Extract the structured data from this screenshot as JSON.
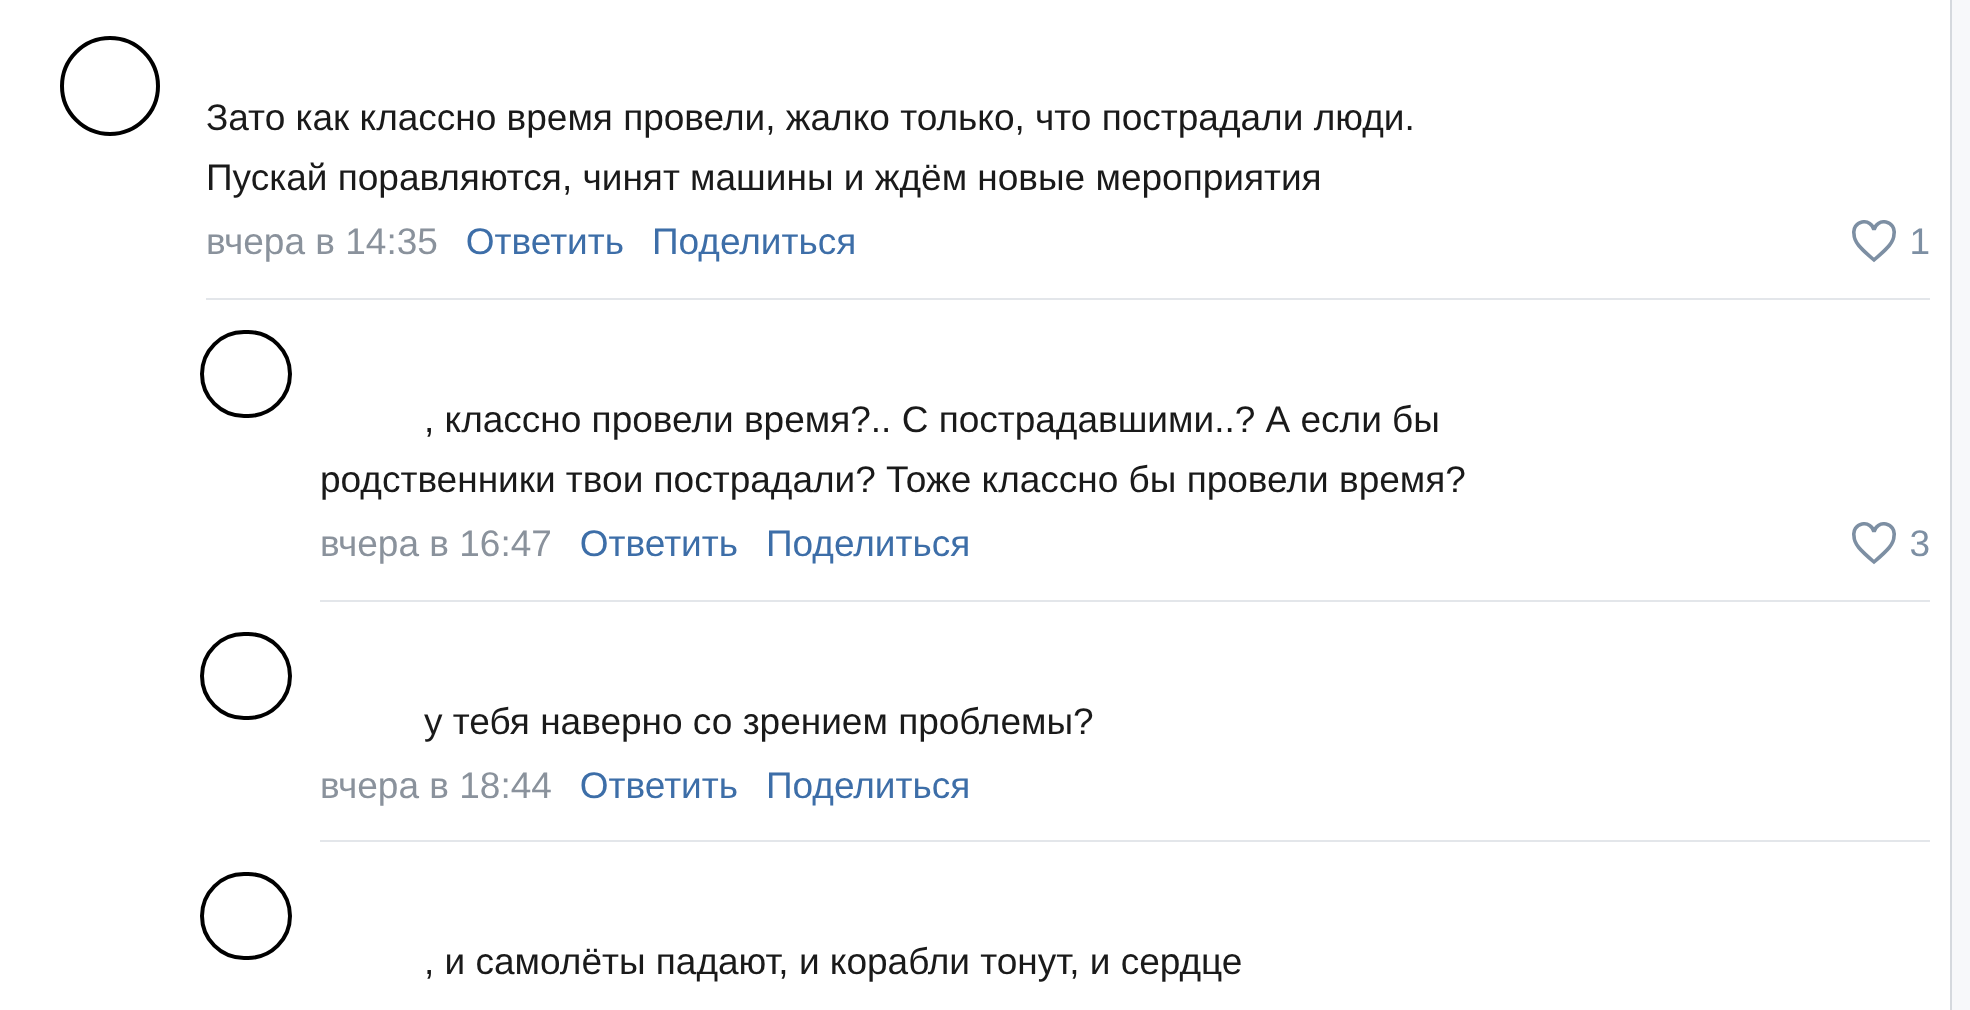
{
  "comments": [
    {
      "kind": "top",
      "text": "Зато как классно время провели, жалко только, что пострадали люди.\nПускай поравляются, чинят машины и ждём новые мероприятия",
      "time": "вчера в 14:35",
      "actions": [
        "Ответить",
        "Поделиться"
      ],
      "likes": "1"
    },
    {
      "kind": "reply",
      "text": ", классно провели время?.. С пострадавшими..? А если бы\nродственники твои пострадали? Тоже классно бы провели время?",
      "time": "вчера в 16:47",
      "actions": [
        "Ответить",
        "Поделиться"
      ],
      "likes": "3"
    },
    {
      "kind": "reply",
      "text": "у тебя наверно со зрением проблемы?",
      "time": "вчера в 18:44",
      "actions": [
        "Ответить",
        "Поделиться"
      ]
    },
    {
      "kind": "reply",
      "text": ", и самолёты падают, и корабли тонут, и сердце"
    }
  ]
}
